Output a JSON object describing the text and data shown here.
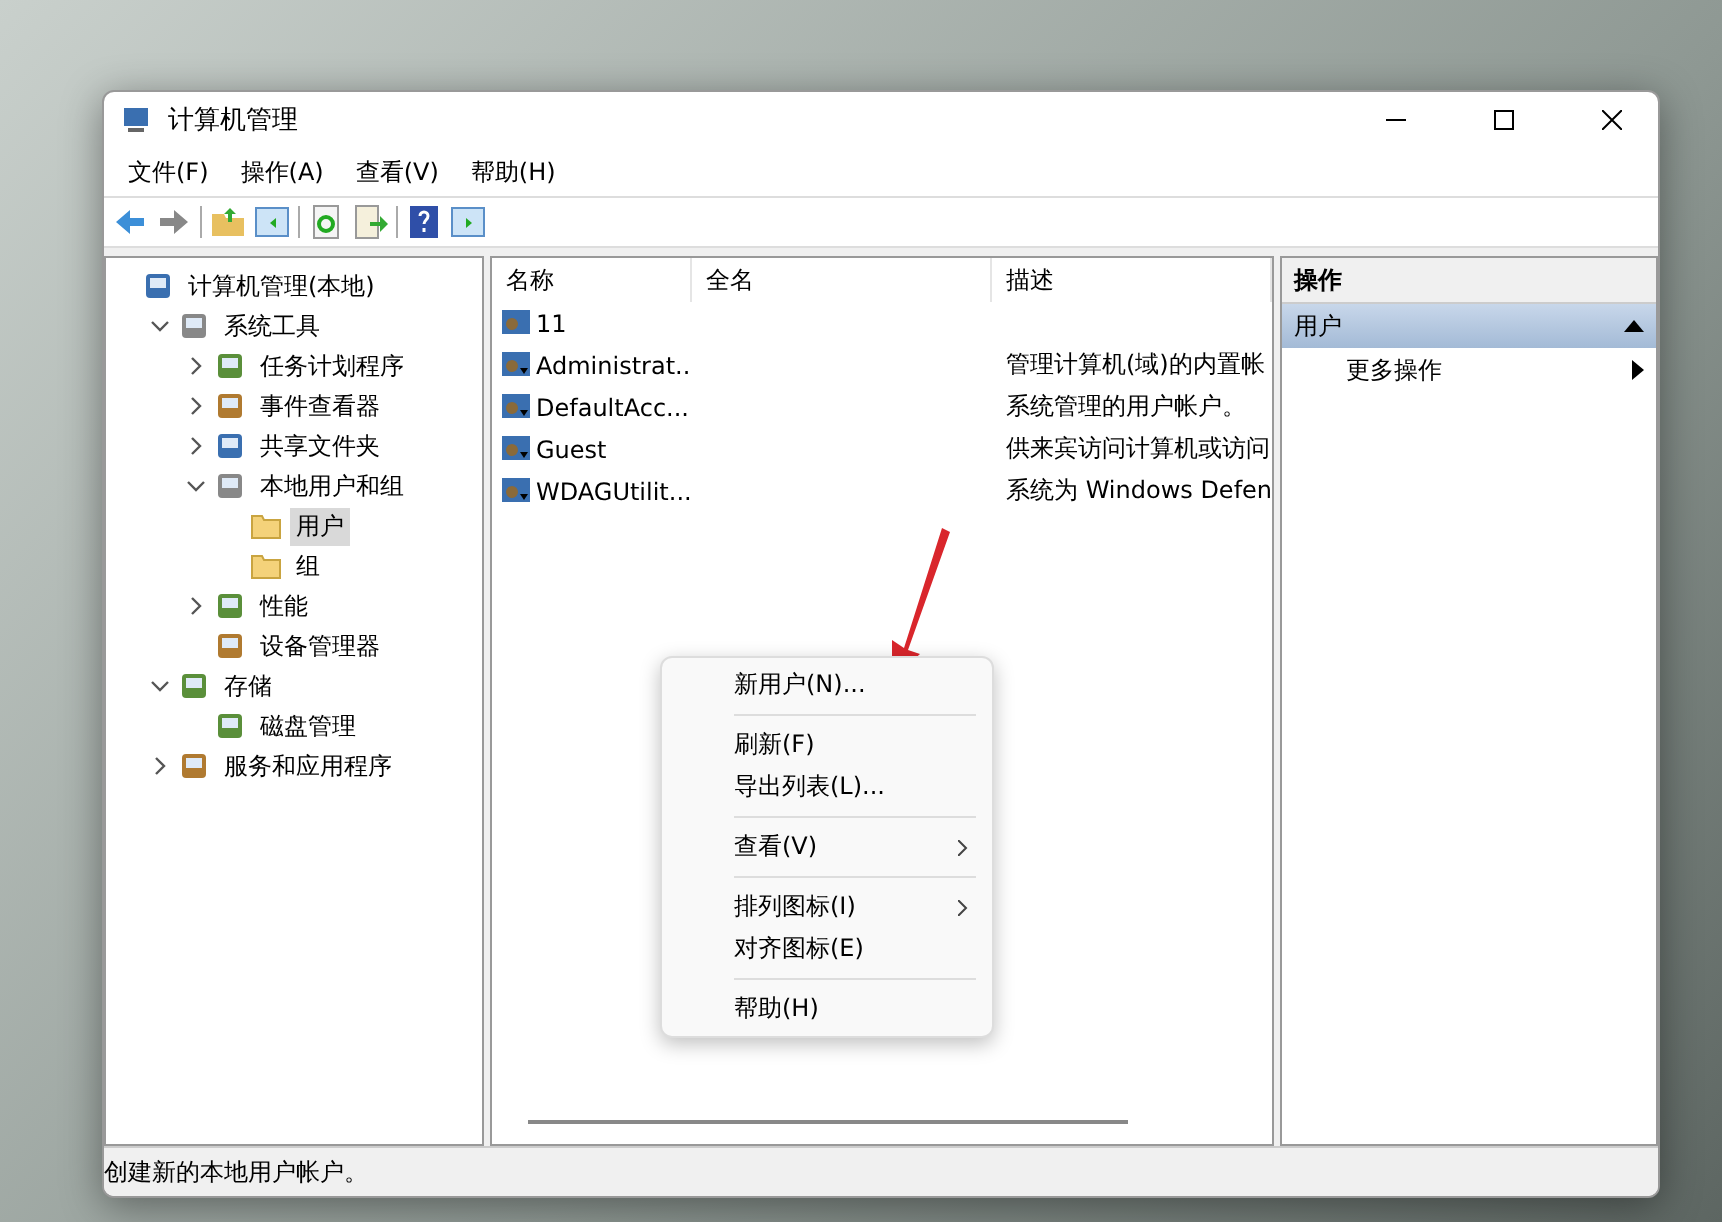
{
  "window": {
    "title": "计算机管理"
  },
  "menu": [
    "文件(F)",
    "操作(A)",
    "查看(V)",
    "帮助(H)"
  ],
  "tree": [
    {
      "label": "计算机管理(本地)",
      "selected": false,
      "children": [
        {
          "label": "系统工具",
          "selected": false,
          "expanded": true,
          "children": [
            {
              "label": "任务计划程序",
              "selected": false,
              "expanded": false
            },
            {
              "label": "事件查看器",
              "selected": false,
              "expanded": false
            },
            {
              "label": "共享文件夹",
              "selected": false,
              "expanded": false
            },
            {
              "label": "本地用户和组",
              "selected": false,
              "expanded": true,
              "children": [
                {
                  "label": "用户",
                  "selected": true,
                  "kind": "folder"
                },
                {
                  "label": "组",
                  "selected": false,
                  "kind": "folder"
                }
              ]
            },
            {
              "label": "性能",
              "selected": false,
              "expanded": false
            },
            {
              "label": "设备管理器",
              "selected": false
            }
          ]
        },
        {
          "label": "存储",
          "selected": false,
          "expanded": true,
          "children": [
            {
              "label": "磁盘管理",
              "selected": false
            }
          ]
        },
        {
          "label": "服务和应用程序",
          "selected": false,
          "expanded": false
        }
      ]
    }
  ],
  "table": {
    "columns": [
      "名称",
      "全名",
      "描述"
    ],
    "rows": [
      {
        "name": "11",
        "description": ""
      },
      {
        "name": "Administrat...",
        "description": "管理计算机(域)的内置帐"
      },
      {
        "name": "DefaultAcc...",
        "description": "系统管理的用户帐户。"
      },
      {
        "name": "Guest",
        "description": "供来宾访问计算机或访问"
      },
      {
        "name": "WDAGUtilit...",
        "description": "系统为 Windows Defen"
      }
    ]
  },
  "actions": {
    "header": "操作",
    "section": {
      "label": "用户",
      "expanded": true
    },
    "items": [
      {
        "label": "更多操作"
      }
    ]
  },
  "context_menu": [
    [
      {
        "label": "新用户(N)...",
        "submenu": false
      }
    ],
    [
      {
        "label": "刷新(F)",
        "submenu": false
      },
      {
        "label": "导出列表(L)...",
        "submenu": false
      }
    ],
    [
      {
        "label": "查看(V)",
        "submenu": true
      }
    ],
    [
      {
        "label": "排列图标(I)",
        "submenu": true
      },
      {
        "label": "对齐图标(E)",
        "submenu": false
      }
    ],
    [
      {
        "label": "帮助(H)",
        "submenu": false
      }
    ]
  ],
  "status_bar": "创建新的本地用户帐户。"
}
